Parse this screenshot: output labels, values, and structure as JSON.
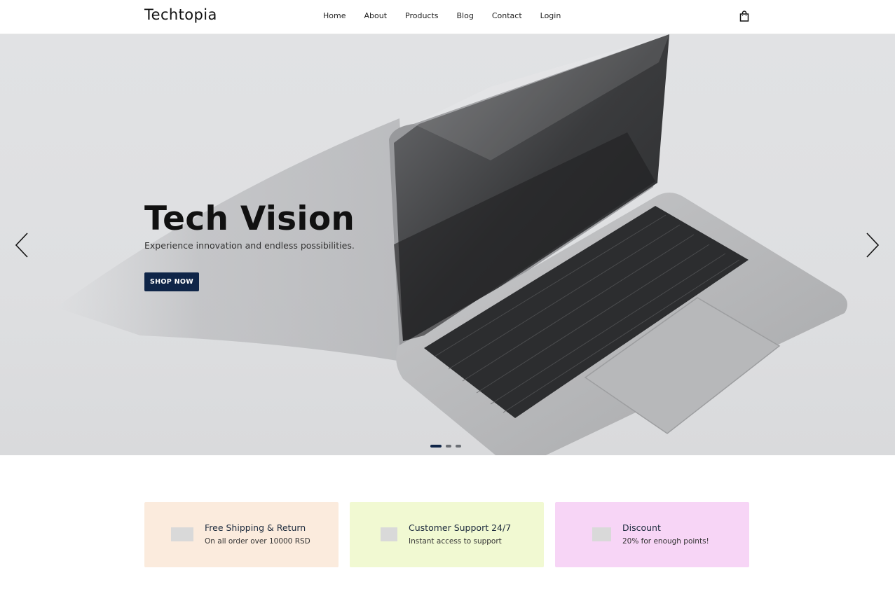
{
  "header": {
    "logo": "Techtopia",
    "nav": [
      "Home",
      "About",
      "Products",
      "Blog",
      "Contact",
      "Login"
    ],
    "cart_icon": "shopping-bag-icon"
  },
  "hero": {
    "title": "Tech Vision",
    "subtitle": "Experience innovation and endless possibilities.",
    "button_label": "SHOP NOW",
    "prev_icon": "chevron-left-icon",
    "next_icon": "chevron-right-icon",
    "slides_count": 3,
    "active_slide": 1
  },
  "features": [
    {
      "title": "Free Shipping & Return",
      "subtitle": "On all order over 10000 RSD",
      "bg": "#fbebdd"
    },
    {
      "title": "Customer Support 24/7",
      "subtitle": "Instant access to support",
      "bg": "#f1f9d2"
    },
    {
      "title": "Discount",
      "subtitle": "20% for enough points!",
      "bg": "#f7d5f6"
    }
  ],
  "colors": {
    "accent": "#0f2548"
  }
}
